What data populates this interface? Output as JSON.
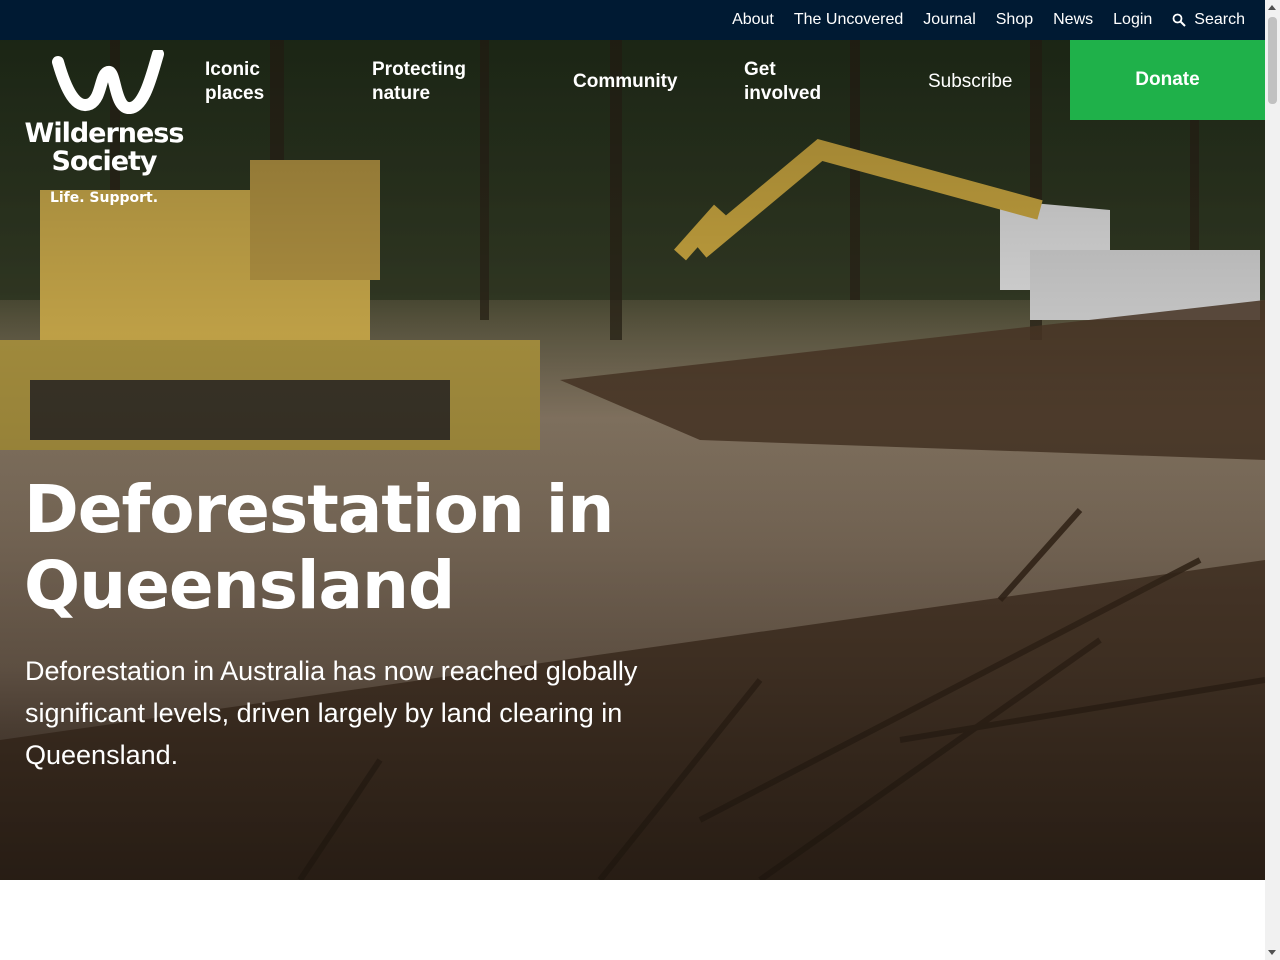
{
  "topbar": {
    "links": [
      "About",
      "The Uncovered",
      "Journal",
      "Shop",
      "News",
      "Login"
    ],
    "search_label": "Search"
  },
  "logo": {
    "name_line1": "Wilderness",
    "name_line2": "Society",
    "tagline": "Life. Support."
  },
  "nav": {
    "iconic_places": [
      "Iconic",
      "places"
    ],
    "protecting_nature": [
      "Protecting",
      "nature"
    ],
    "community": "Community",
    "get_involved": [
      "Get",
      "involved"
    ],
    "subscribe": "Subscribe",
    "donate": "Donate"
  },
  "hero": {
    "title_line1": "Deforestation in",
    "title_line2": "Queensland",
    "subtitle": "Deforestation in Australia has now reached globally significant levels, driven largely by land clearing in Queensland."
  },
  "colors": {
    "topbar_bg": "#001a33",
    "donate_bg": "#1fb14a",
    "text": "#ffffff"
  }
}
